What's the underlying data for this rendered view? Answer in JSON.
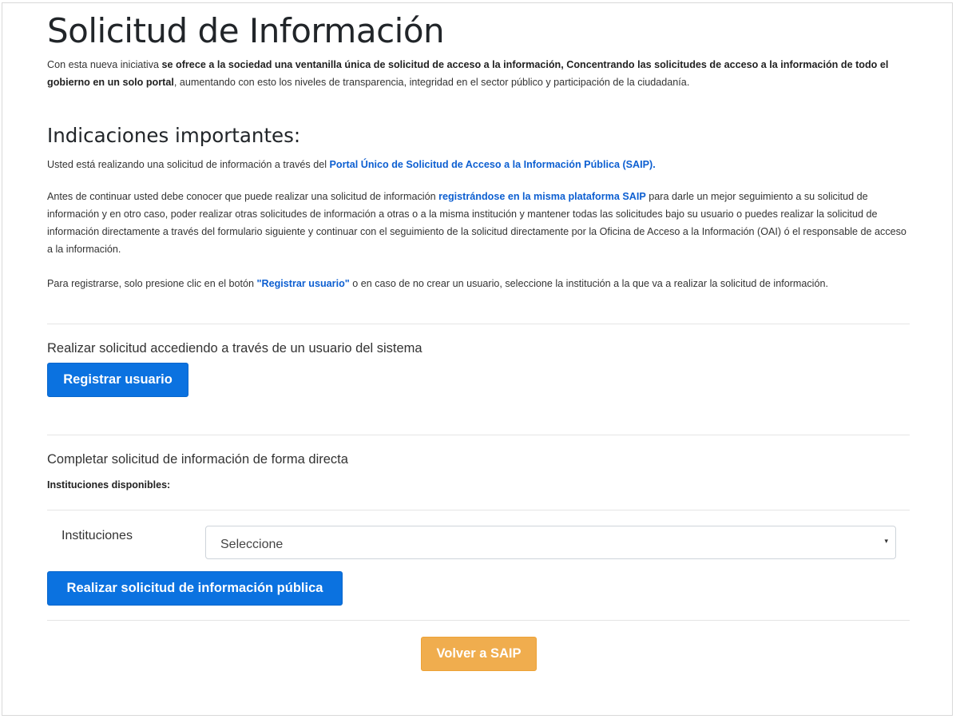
{
  "page": {
    "title": "Solicitud de Información",
    "intro": {
      "pre": "Con esta nueva iniciativa ",
      "bold": "se ofrece a la sociedad una ventanilla única de solicitud de acceso a la información, Concentrando las solicitudes de acceso a la información de todo el gobierno en un solo portal",
      "post": ", aumentando con esto los niveles de transparencia, integridad en el sector público y participación de la ciudadanía."
    },
    "important_heading": "Indicaciones importantes:",
    "para1": {
      "pre": "Usted está realizando una solicitud de información a través del ",
      "link": "Portal Único de Solicitud de Acceso a la Información Pública (SAIP)."
    },
    "para2": {
      "pre": "Antes de continuar usted debe conocer que puede realizar una solicitud de información ",
      "link": "registrándose en la misma plataforma SAIP",
      "post": " para darle un mejor seguimiento a su solicitud de información y en otro caso, poder realizar otras solicitudes de información a otras o a la misma institución y mantener todas las solicitudes bajo su usuario o puedes realizar la solicitud de información directamente a través del formulario siguiente y continuar con el seguimiento de la solicitud directamente por la Oficina de Acceso a la Información (OAI) ó el responsable de acceso a la información."
    },
    "para3": {
      "pre": "Para registrarse, solo presione clic en el botón ",
      "link": "\"Registrar usuario\"",
      "post": " o en caso de no crear un usuario, seleccione la institución a la que va a realizar la solicitud de información."
    }
  },
  "user_section": {
    "title": "Realizar solicitud accediendo a través de un usuario del sistema",
    "register_button": "Registrar usuario"
  },
  "direct_section": {
    "title": "Completar solicitud de información de forma directa",
    "available_label": "Instituciones disponibles:",
    "institutions_label": "Instituciones",
    "select_value": "Seleccione",
    "submit_button": "Realizar solicitud de información pública"
  },
  "footer": {
    "back_button": "Volver a SAIP"
  },
  "colors": {
    "primary": "#0b72e0",
    "warning": "#f0ad4e",
    "link": "#0d5fd1"
  },
  "icons": {
    "select_caret": "▾"
  }
}
